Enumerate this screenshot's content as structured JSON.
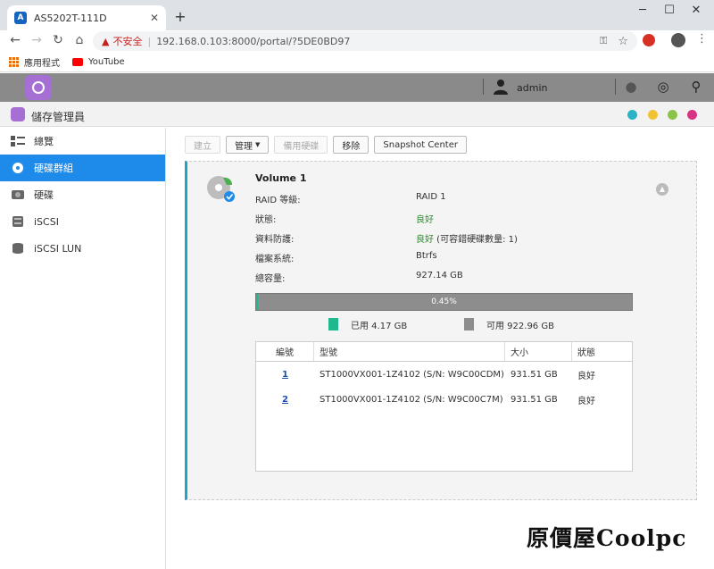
{
  "browser": {
    "tab_title": "AS5202T-111D",
    "new_tab": "+",
    "window_minimize": "─",
    "window_maximize": "☐",
    "window_close": "✕",
    "insecure_label": "不安全",
    "url": "192.168.0.103:8000/portal/?5DE0BD97",
    "bookmarks": {
      "apps": "應用程式",
      "youtube": "YouTube"
    }
  },
  "adm": {
    "username": "admin"
  },
  "app": {
    "title": "儲存管理員",
    "window_dots": [
      "#2bb3c5",
      "#f1c232",
      "#8bc34a",
      "#d63384"
    ],
    "sidebar": [
      {
        "label": "總覽",
        "icon": "overview-icon",
        "active": false
      },
      {
        "label": "硬碟群組",
        "icon": "volume-icon",
        "active": true
      },
      {
        "label": "硬碟",
        "icon": "disk-icon",
        "active": false
      },
      {
        "label": "iSCSI",
        "icon": "iscsi-icon",
        "active": false
      },
      {
        "label": "iSCSI LUN",
        "icon": "iscsi-lun-icon",
        "active": false
      }
    ],
    "toolbar": {
      "create": "建立",
      "manage": "管理",
      "spare": "備用硬碟",
      "remove": "移除",
      "snapshot": "Snapshot Center"
    },
    "volume": {
      "title": "Volume 1",
      "rows": [
        {
          "label": "RAID 等級:",
          "value": "RAID 1"
        },
        {
          "label": "狀態:",
          "value": "良好"
        },
        {
          "label": "資料防護:",
          "value_good": "良好",
          "value_rest": " (可容錯硬碟數量: 1)"
        },
        {
          "label": "檔案系統:",
          "value": "Btrfs"
        },
        {
          "label": "總容量:",
          "value": "927.14 GB"
        }
      ],
      "usage_percent": 0.45,
      "usage_label": "0.45%",
      "used_label": "已用 4.17 GB",
      "free_label": "可用 922.96 GB",
      "used_color": "#1fb98d",
      "free_color": "#8d8d8d",
      "table": {
        "headers": [
          "編號",
          "型號",
          "大小",
          "狀態"
        ],
        "rows": [
          [
            "1",
            "ST1000VX001-1Z4102 (S/N: W9C00CDM)",
            "931.51 GB",
            "良好"
          ],
          [
            "2",
            "ST1000VX001-1Z4102 (S/N: W9C00C7M)",
            "931.51 GB",
            "良好"
          ]
        ]
      }
    }
  },
  "watermark": "原價屋Coolpc"
}
